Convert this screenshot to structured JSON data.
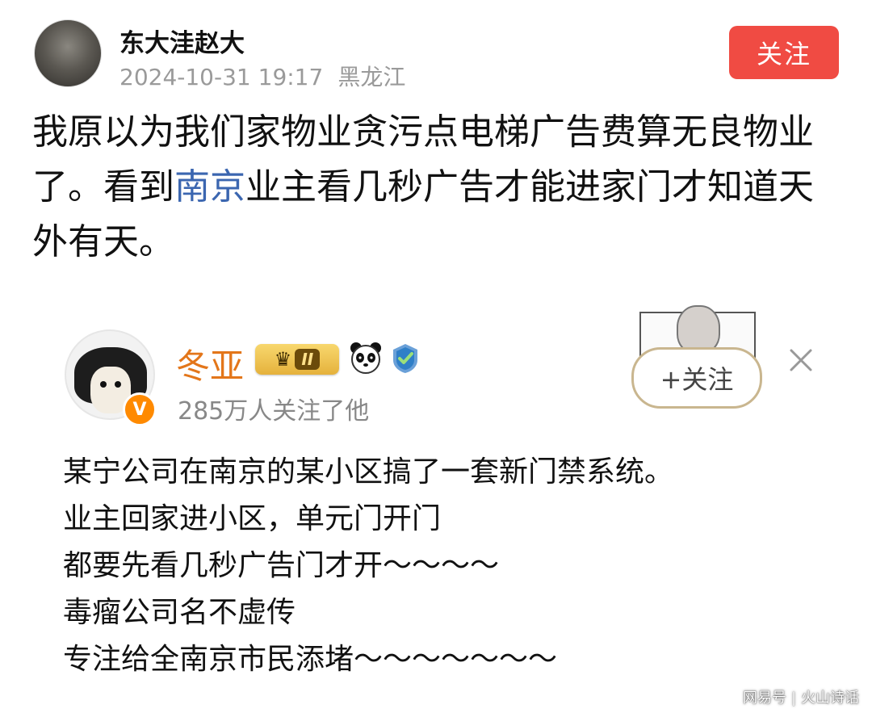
{
  "post": {
    "username": "东大洼赵大",
    "date": "2024-10-31 19:17",
    "location": "黑龙江",
    "follow_label": "关注",
    "text_before_link": "我原以为我们家物业贪污点电梯广告费算无良物业了。看到",
    "text_link": "南京",
    "text_after_link": "业主看几秒广告才能进家门才知道天外有天。"
  },
  "quoted": {
    "username": "冬亚",
    "vip_level": "II",
    "verified_badge": "V",
    "followers_text": "285万人关注了他",
    "follow_label": "+关注",
    "lines": [
      "某宁公司在南京的某小区搞了一套新门禁系统。",
      "业主回家进小区，单元门开门",
      "都要先看几秒广告门才开～～～～",
      "毒瘤公司名不虚传",
      "专注给全南京市民添堵～～～～～～～"
    ]
  },
  "watermark": {
    "source": "网易号",
    "author": "火山诗话"
  },
  "colors": {
    "follow_button": "#f04b43",
    "link": "#3b66b0",
    "quoted_username": "#e3761a"
  },
  "icons": [
    "avatar",
    "vip-crown-icon",
    "panda-icon",
    "verified-shield-icon",
    "close-icon"
  ]
}
